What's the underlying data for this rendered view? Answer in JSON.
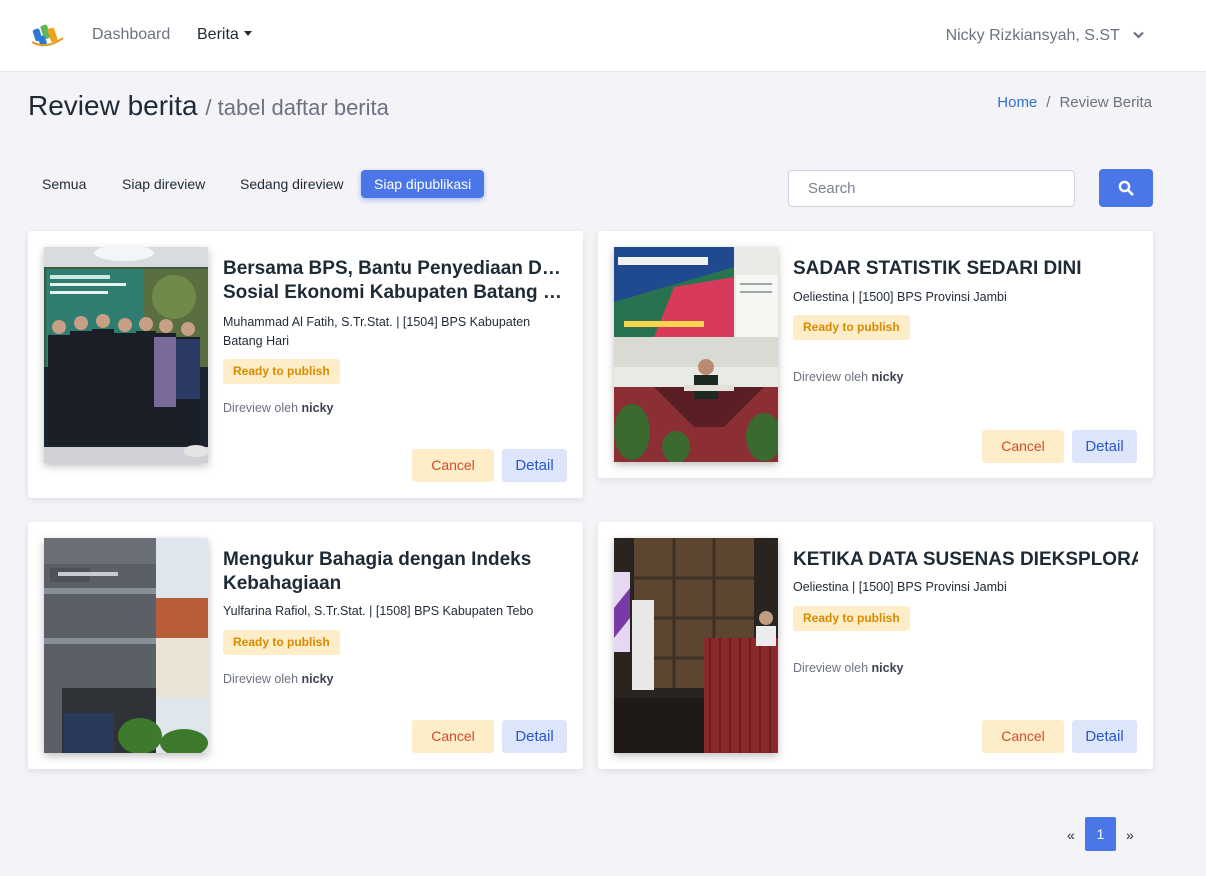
{
  "navbar": {
    "dashboard_label": "Dashboard",
    "berita_label": "Berita",
    "user_name": "Nicky Rizkiansyah, S.ST"
  },
  "header": {
    "title": "Review berita",
    "subtitle": "/ tabel daftar berita",
    "breadcrumb_home": "Home",
    "breadcrumb_current": "Review Berita"
  },
  "tabs": [
    {
      "label": "Semua",
      "active": false
    },
    {
      "label": "Siap direview",
      "active": false
    },
    {
      "label": "Sedang direview",
      "active": false
    },
    {
      "label": "Siap dipublikasi",
      "active": true
    }
  ],
  "search": {
    "placeholder": "Search",
    "value": ""
  },
  "reviewed_prefix": "Direview oleh",
  "cards": [
    {
      "title_line1": "Bersama BPS, Bantu Penyediaan Data",
      "title_line2": "Sosial Ekonomi Kabupaten Batang Hari",
      "author": "Muhammad Al Fatih, S.Tr.Stat. | [1504] BPS Kabupaten Batang Hari",
      "status": "Ready to publish",
      "reviewer": "nicky",
      "cancel_label": "Cancel",
      "detail_label": "Detail"
    },
    {
      "title": "SADAR STATISTIK SEDARI DINI",
      "author": "Oeliestina | [1500] BPS Provinsi Jambi",
      "status": "Ready to publish",
      "reviewer": "nicky",
      "cancel_label": "Cancel",
      "detail_label": "Detail"
    },
    {
      "title_line1": "Mengukur Bahagia dengan Indeks",
      "title_line2": "Kebahagiaan",
      "author": "Yulfarina Rafiol, S.Tr.Stat. | [1508] BPS Kabupaten Tebo",
      "status": "Ready to publish",
      "reviewer": "nicky",
      "cancel_label": "Cancel",
      "detail_label": "Detail"
    },
    {
      "title": "KETIKA DATA SUSENAS DIEKSPLORASI",
      "author": "Oeliestina | [1500] BPS Provinsi Jambi",
      "status": "Ready to publish",
      "reviewer": "nicky",
      "cancel_label": "Cancel",
      "detail_label": "Detail"
    }
  ],
  "pagination": {
    "prev": "«",
    "current_page": "1",
    "next": "»"
  },
  "colors": {
    "primary": "#4a76e8",
    "badge_bg": "#fdeec9",
    "badge_text": "#d98a00",
    "link": "#2f6fd8"
  }
}
